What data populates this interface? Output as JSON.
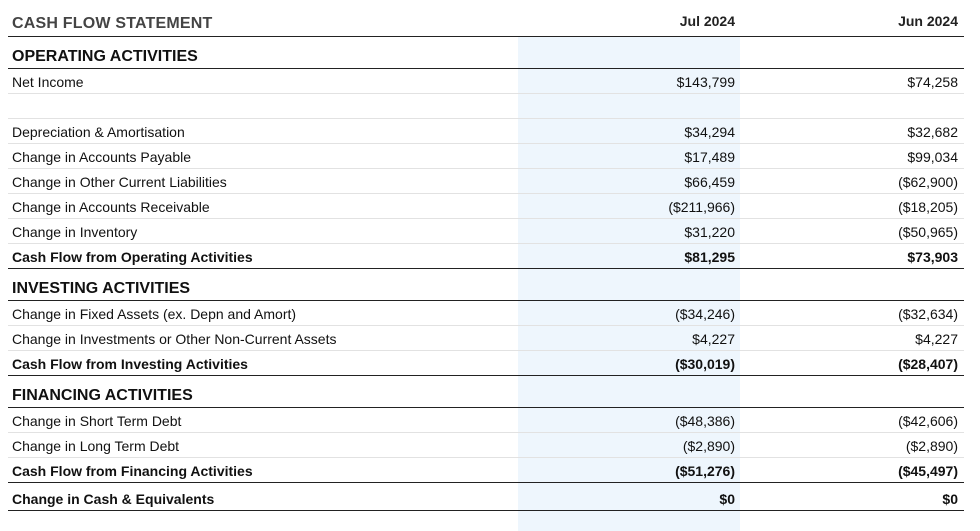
{
  "title": "CASH FLOW STATEMENT",
  "columns": [
    "Jul 2024",
    "Jun 2024"
  ],
  "operating": {
    "heading": "OPERATING ACTIVITIES",
    "net_income": {
      "label": "Net Income",
      "v1": "$143,799",
      "v2": "$74,258"
    },
    "rows": [
      {
        "label": "Depreciation & Amortisation",
        "v1": "$34,294",
        "v2": "$32,682"
      },
      {
        "label": "Change in Accounts Payable",
        "v1": "$17,489",
        "v2": "$99,034"
      },
      {
        "label": "Change in Other Current Liabilities",
        "v1": "$66,459",
        "v2": "($62,900)"
      },
      {
        "label": "Change in Accounts Receivable",
        "v1": "($211,966)",
        "v2": "($18,205)"
      },
      {
        "label": "Change in Inventory",
        "v1": "$31,220",
        "v2": "($50,965)"
      }
    ],
    "total": {
      "label": "Cash Flow from Operating Activities",
      "v1": "$81,295",
      "v2": "$73,903"
    }
  },
  "investing": {
    "heading": "INVESTING ACTIVITIES",
    "rows": [
      {
        "label": "Change in Fixed Assets (ex. Depn and Amort)",
        "v1": "($34,246)",
        "v2": "($32,634)"
      },
      {
        "label": "Change in Investments or Other Non-Current Assets",
        "v1": "$4,227",
        "v2": "$4,227"
      }
    ],
    "total": {
      "label": "Cash Flow from Investing Activities",
      "v1": "($30,019)",
      "v2": "($28,407)"
    }
  },
  "financing": {
    "heading": "FINANCING ACTIVITIES",
    "rows": [
      {
        "label": "Change in Short Term Debt",
        "v1": "($48,386)",
        "v2": "($42,606)"
      },
      {
        "label": "Change in Long Term Debt",
        "v1": "($2,890)",
        "v2": "($2,890)"
      }
    ],
    "total": {
      "label": "Cash Flow from Financing Activities",
      "v1": "($51,276)",
      "v2": "($45,497)"
    }
  },
  "grand_total": {
    "label": "Change in Cash & Equivalents",
    "v1": "$0",
    "v2": "$0"
  },
  "colors": {
    "highlight_column": "#eef6fd",
    "rule": "#222222",
    "divider": "#e2e2e2"
  }
}
